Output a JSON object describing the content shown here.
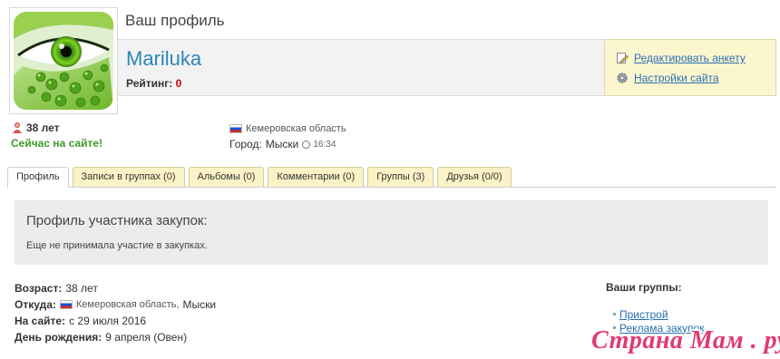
{
  "header": {
    "title": "Ваш профиль"
  },
  "profile": {
    "username": "Mariluka",
    "rating_label": "Рейтинг:",
    "rating_value": "0"
  },
  "actions": {
    "edit_label": "Редактировать анкету",
    "settings_label": "Настройки сайта",
    "edit_icon": "pencil-icon",
    "settings_icon": "gear-icon"
  },
  "summary": {
    "age": "38 лет",
    "online": "Сейчас на сайте!",
    "region": "Кемеровская область",
    "city_label": "Город:",
    "city": "Мыски",
    "local_time": "16:34"
  },
  "tabs": [
    {
      "label": "Профиль"
    },
    {
      "label": "Записи в группах (0)"
    },
    {
      "label": "Альбомы (0)"
    },
    {
      "label": "Комментарии (0)"
    },
    {
      "label": "Группы (3)"
    },
    {
      "label": "Друзья (0/0)"
    }
  ],
  "panel": {
    "title": "Профиль участника закупок:",
    "text": "Еще не принимала участие в закупках."
  },
  "details": {
    "age_label": "Возраст:",
    "age_value": "38 лет",
    "from_label": "Откуда:",
    "from_region": "Кемеровская область,",
    "from_city": "Мыски",
    "since_label": "На сайте:",
    "since_value": "с 29 июля 2016",
    "birthday_label": "День рождения:",
    "birthday_value": "9 апреля (Овен)"
  },
  "groups": {
    "title": "Ваши группы:",
    "items": [
      "Пристрой",
      "Реклама закупок"
    ]
  },
  "watermark": "Страна Мам . ру",
  "colors": {
    "username": "#2b86b8",
    "online": "#3d9a2a",
    "rating": "#cc0000",
    "actions_bg": "#fcf6cf",
    "tab_bg": "#fbf3c6",
    "link": "#2a6fb0",
    "watermark": "#e23a6e"
  }
}
